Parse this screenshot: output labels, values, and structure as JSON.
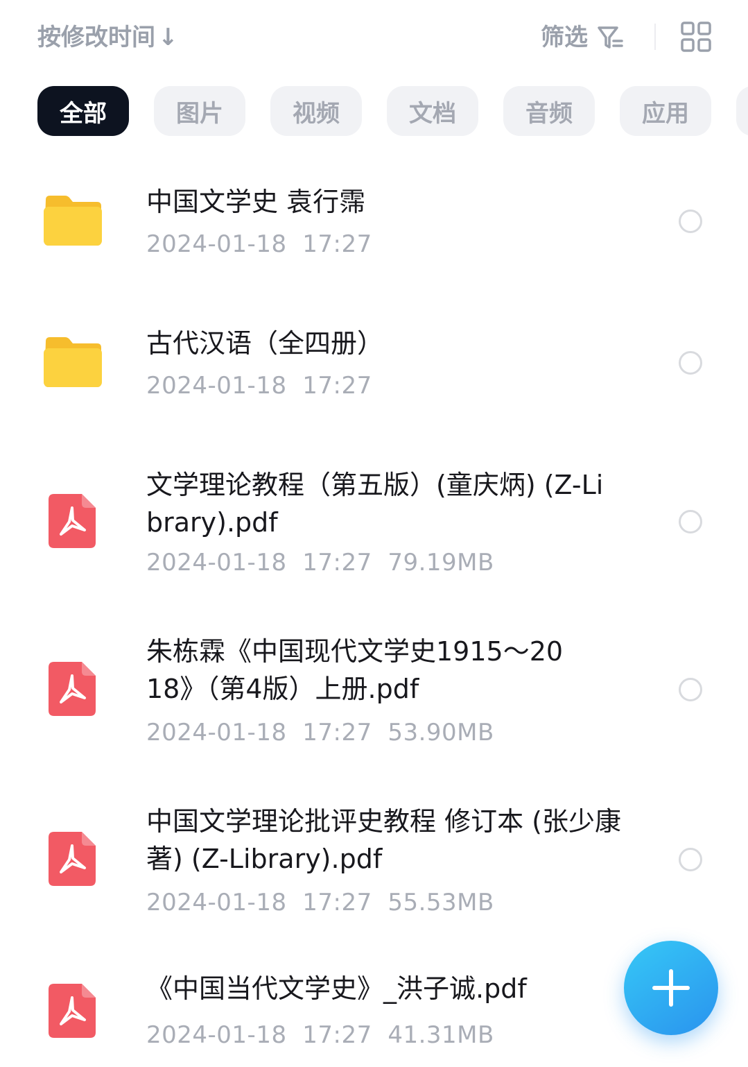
{
  "toolbar": {
    "sort_label": "按修改时间",
    "sort_arrow": "↓",
    "filter_label": "筛选"
  },
  "tabs": [
    {
      "label": "全部",
      "active": true
    },
    {
      "label": "图片",
      "active": false
    },
    {
      "label": "视频",
      "active": false
    },
    {
      "label": "文档",
      "active": false
    },
    {
      "label": "音频",
      "active": false
    },
    {
      "label": "应用",
      "active": false
    }
  ],
  "files": [
    {
      "name": "中国文学史 袁行霈",
      "type": "folder",
      "date": "2024-01-18",
      "time": "17:27",
      "size": ""
    },
    {
      "name": "古代汉语（全四册）",
      "type": "folder",
      "date": "2024-01-18",
      "time": "17:27",
      "size": ""
    },
    {
      "name": "文学理论教程（第五版）(童庆炳) (Z-Library).pdf",
      "type": "pdf",
      "date": "2024-01-18",
      "time": "17:27",
      "size": "79.19MB"
    },
    {
      "name": "朱栋霖《中国现代文学史1915～2018》（第4版）上册.pdf",
      "type": "pdf",
      "date": "2024-01-18",
      "time": "17:27",
      "size": "53.90MB"
    },
    {
      "name": "中国文学理论批评史教程 修订本 (张少康著) (Z-Library).pdf",
      "type": "pdf",
      "date": "2024-01-18",
      "time": "17:27",
      "size": "55.53MB"
    },
    {
      "name": "《中国当代文学史》_洪子诚.pdf",
      "type": "pdf",
      "date": "2024-01-18",
      "time": "17:27",
      "size": "41.31MB"
    }
  ],
  "icons": {
    "sort": "arrow-down-icon",
    "filter": "filter-icon",
    "view": "grid-view-icon",
    "folder": "folder-icon",
    "pdf": "pdf-icon",
    "add": "plus-icon"
  },
  "colors": {
    "active_tab_bg": "#0d1320",
    "folder": "#fcd23f",
    "pdf": "#f25a64",
    "fab": "#2fa8f2"
  }
}
